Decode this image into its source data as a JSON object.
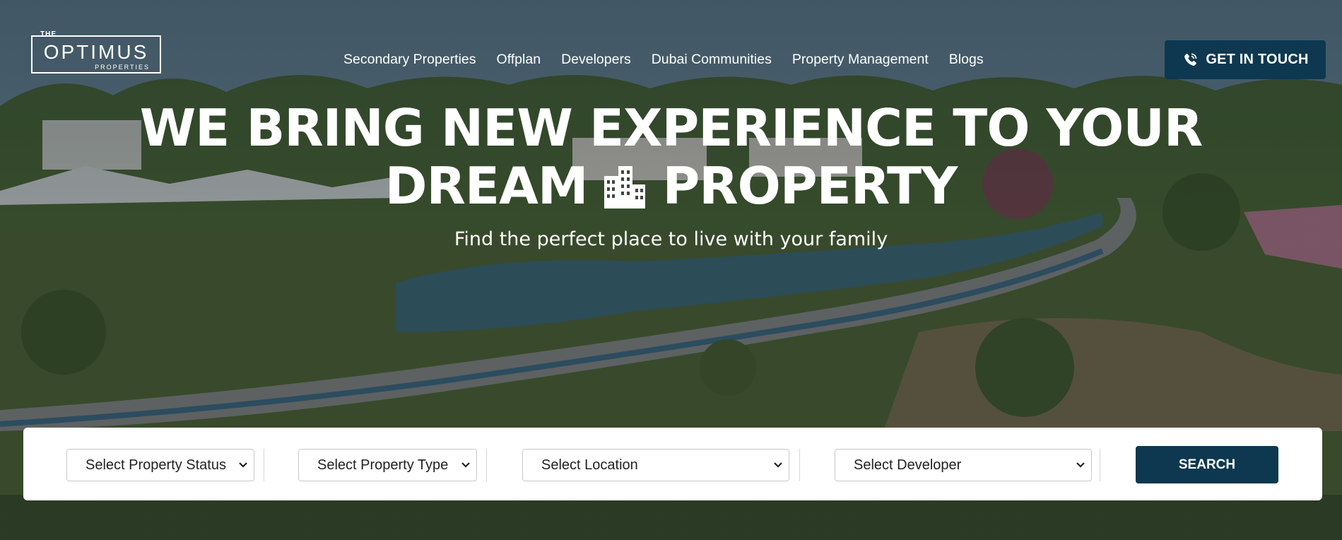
{
  "brand": {
    "logo_top": "THE",
    "logo_word": "OPTIMUS",
    "logo_sub": "PROPERTIES"
  },
  "nav": {
    "items": [
      {
        "label": "Secondary Properties"
      },
      {
        "label": "Offplan"
      },
      {
        "label": "Developers"
      },
      {
        "label": "Dubai Communities"
      },
      {
        "label": "Property Management"
      },
      {
        "label": "Blogs"
      }
    ]
  },
  "cta": {
    "label": "GET IN TOUCH",
    "icon": "phone-icon"
  },
  "hero": {
    "line1": "WE BRING NEW EXPERIENCE TO YOUR",
    "line2_a": "DREAM",
    "line2_icon": "building-icon",
    "line2_b": "PROPERTY",
    "tagline": "Find the perfect place to live with your family"
  },
  "search": {
    "status": "Select Property Status",
    "type": "Select Property Type",
    "location": "Select Location",
    "developer": "Select Developer",
    "button": "SEARCH"
  },
  "colors": {
    "accent": "#0d3850",
    "text_light": "#ffffff"
  }
}
